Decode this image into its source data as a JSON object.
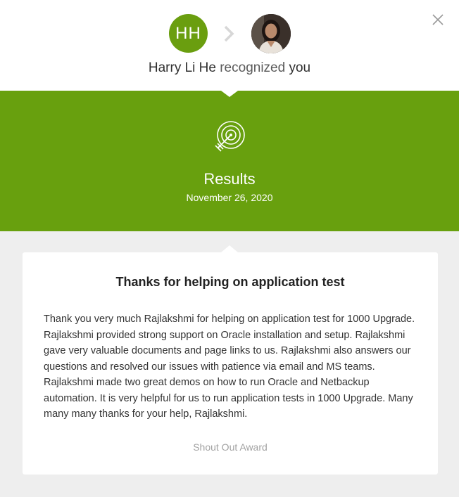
{
  "header": {
    "sender_initials": "HH",
    "sender_name": "Harry Li He",
    "verb": "recognized",
    "recipient": "you"
  },
  "banner": {
    "icon": "target-icon",
    "title": "Results",
    "date": "November 26, 2020"
  },
  "card": {
    "title": "Thanks for helping on application test",
    "message": "Thank you very much Rajlakshmi for helping on application test for 1000 Upgrade. Rajlakshmi provided strong support on Oracle installation and setup. Rajlakshmi gave very valuable documents and page links to us. Rajlakshmi also answers our questions and resolved our issues with patience via email and MS teams. Rajlakshmi made two great demos on how to run Oracle and Netbackup automation. It is very helpful for us to run application tests in 1000 Upgrade. Many many many thanks for your help, Rajlakshmi.",
    "award": "Shout Out Award"
  },
  "colors": {
    "brand_green": "#68a00e",
    "content_bg": "#eeeeee"
  },
  "icons": {
    "close": "close-icon",
    "arrow": "chevron-right-icon"
  }
}
